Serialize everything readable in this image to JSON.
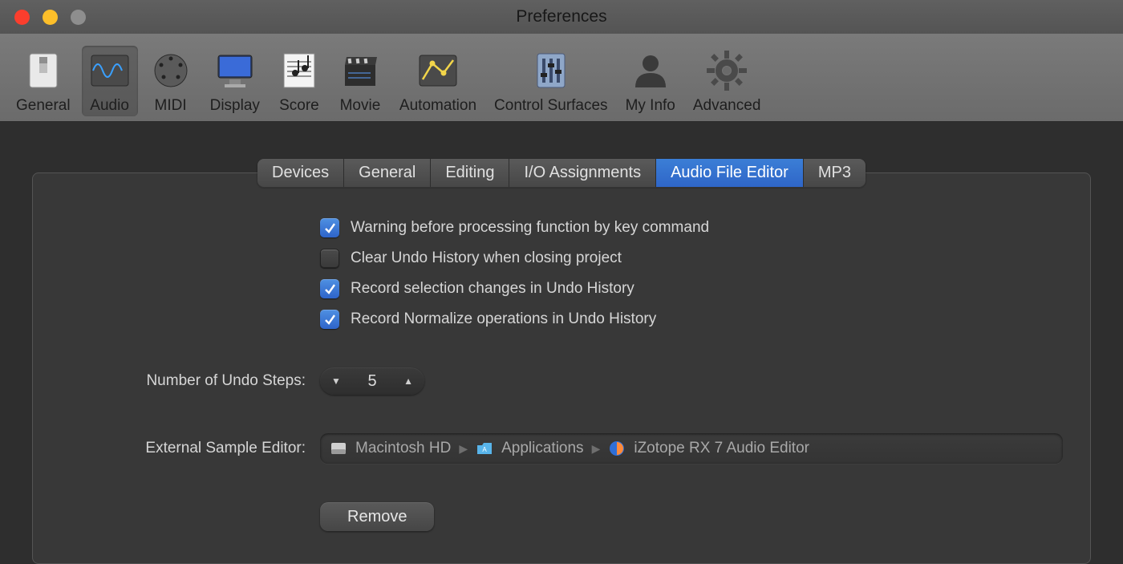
{
  "window": {
    "title": "Preferences"
  },
  "toolbar": {
    "items": [
      {
        "label": "General"
      },
      {
        "label": "Audio"
      },
      {
        "label": "MIDI"
      },
      {
        "label": "Display"
      },
      {
        "label": "Score"
      },
      {
        "label": "Movie"
      },
      {
        "label": "Automation"
      },
      {
        "label": "Control Surfaces"
      },
      {
        "label": "My Info"
      },
      {
        "label": "Advanced"
      }
    ],
    "selected_index": 1
  },
  "tabs": {
    "items": [
      {
        "label": "Devices"
      },
      {
        "label": "General"
      },
      {
        "label": "Editing"
      },
      {
        "label": "I/O Assignments"
      },
      {
        "label": "Audio File Editor"
      },
      {
        "label": "MP3"
      }
    ],
    "active_index": 4
  },
  "checks": {
    "warn_label": "Warning before processing function by key command",
    "warn_checked": true,
    "clear_label": "Clear Undo History when closing project",
    "clear_checked": false,
    "record_sel_label": "Record selection changes in Undo History",
    "record_sel_checked": true,
    "record_norm_label": "Record Normalize operations in Undo History",
    "record_norm_checked": true
  },
  "undo_steps": {
    "label": "Number of Undo Steps:",
    "value": "5"
  },
  "ext_editor": {
    "label": "External Sample Editor:",
    "seg1": "Macintosh HD",
    "seg2": "Applications",
    "seg3": "iZotope RX 7 Audio Editor"
  },
  "remove_label": "Remove"
}
